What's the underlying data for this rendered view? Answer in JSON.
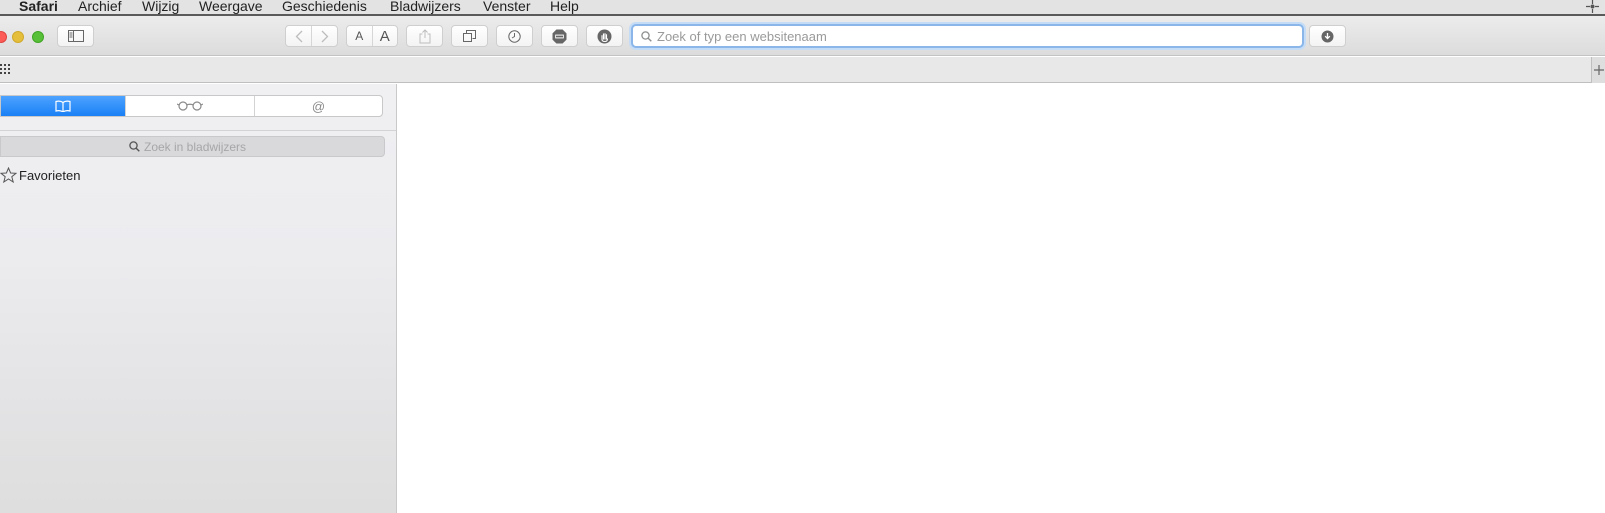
{
  "menubar": {
    "app_name": "Safari",
    "items": [
      "Archief",
      "Wijzig",
      "Weergave",
      "Geschiedenis",
      "Bladwijzers",
      "Venster",
      "Help"
    ]
  },
  "toolbar": {
    "text_smaller_label": "A",
    "text_larger_label": "A",
    "address_placeholder": "Zoek of typ een websitenaam",
    "address_value": ""
  },
  "sidebar": {
    "tabs": [
      "bookmarks",
      "reading-list",
      "shared-links"
    ],
    "active_tab": "bookmarks",
    "shared_links_symbol": "@",
    "search_placeholder": "Zoek in bladwijzers",
    "items": [
      {
        "label": "Favorieten",
        "icon": "star-icon"
      }
    ]
  },
  "colors": {
    "close": "#fc5b57",
    "minimize": "#e5bf3c",
    "zoom": "#57c038",
    "accent": "#1a80f5"
  }
}
